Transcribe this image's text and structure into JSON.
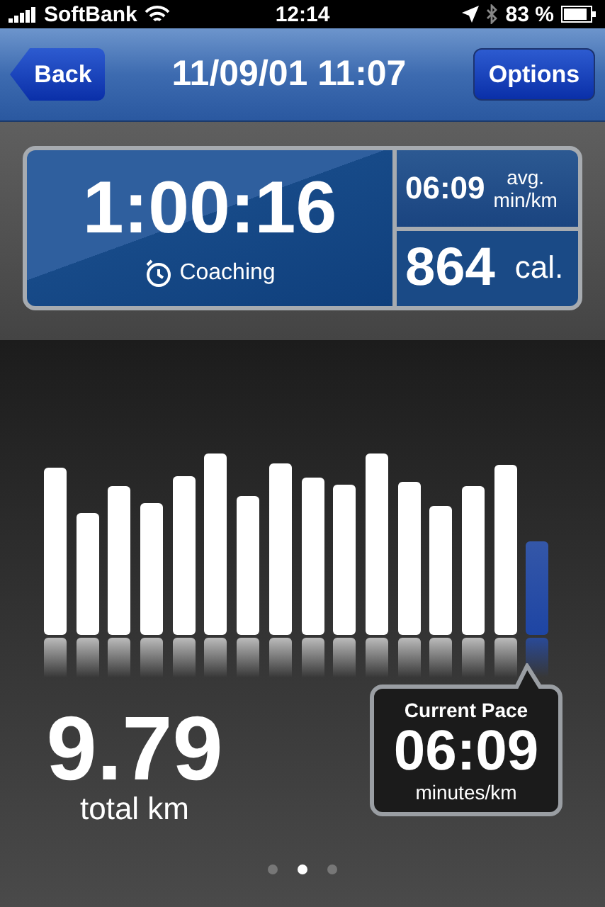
{
  "status_bar": {
    "carrier": "SoftBank",
    "time": "12:14",
    "battery": "83 %"
  },
  "nav_bar": {
    "back": "Back",
    "title": "11/09/01 11:07",
    "options": "Options"
  },
  "summary": {
    "duration": "1:00:16",
    "coaching": "Coaching",
    "avg_pace": "06:09",
    "avg_label_top": "avg.",
    "avg_label_bottom": "min/km",
    "calories": "864",
    "calories_unit": "cal."
  },
  "splits": [
    {
      "selected": false
    },
    {
      "selected": false
    },
    {
      "selected": false
    },
    {
      "selected": false
    },
    {
      "selected": false
    },
    {
      "selected": false
    },
    {
      "selected": false
    },
    {
      "selected": false
    },
    {
      "selected": false
    },
    {
      "selected": false
    },
    {
      "selected": false
    },
    {
      "selected": false
    },
    {
      "selected": false
    },
    {
      "selected": false
    },
    {
      "selected": false
    },
    {
      "selected": true
    }
  ],
  "distance": {
    "value": "9.79",
    "unit": "total km"
  },
  "current_pace": {
    "title": "Current Pace",
    "value": "06:09",
    "unit": "minutes/km"
  },
  "page_dots": [
    {
      "selected": false
    },
    {
      "selected": true
    },
    {
      "selected": false
    }
  ]
}
